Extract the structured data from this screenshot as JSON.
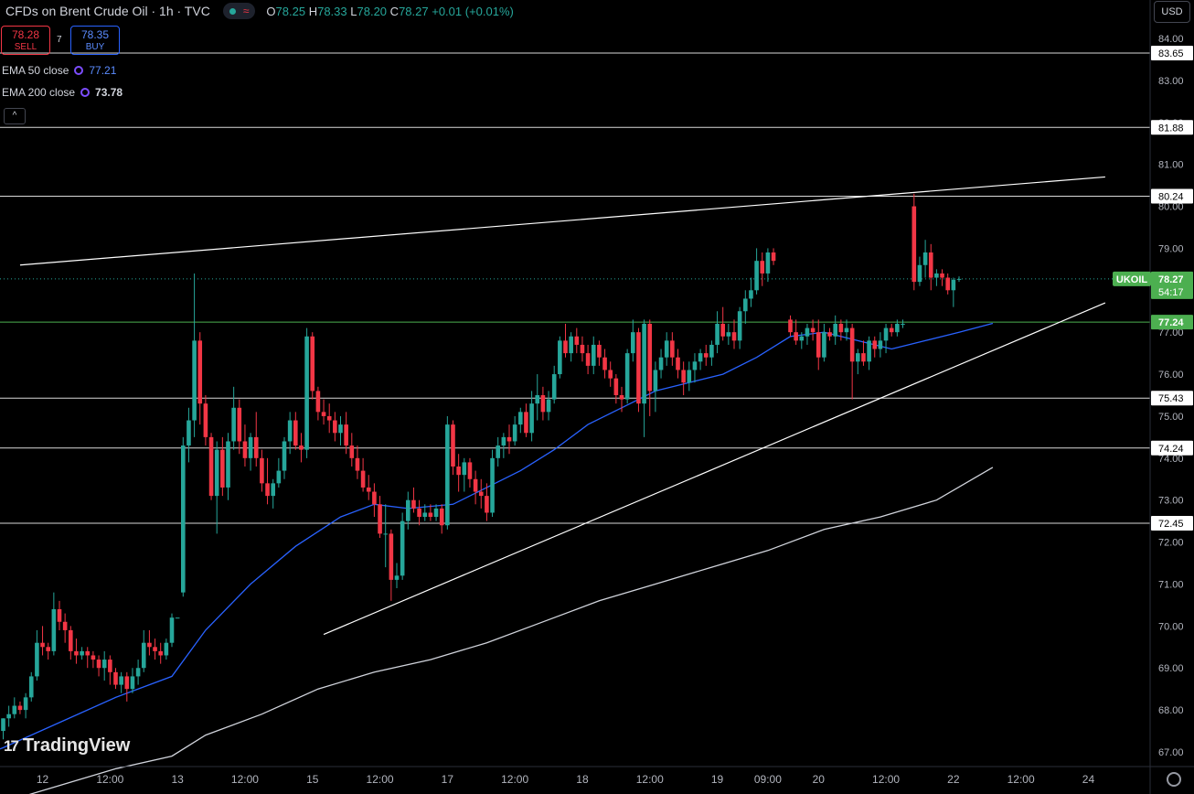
{
  "header": {
    "title": "CFDs on Brent Crude Oil · 1h · TVC",
    "wave_icon": "≈",
    "ohlc": [
      {
        "k": "O",
        "v": "78.25"
      },
      {
        "k": "H",
        "v": "78.33"
      },
      {
        "k": "L",
        "v": "78.20"
      },
      {
        "k": "C",
        "v": "78.27"
      }
    ],
    "change": "+0.01 (+0.01%)"
  },
  "trade": {
    "sell_price": "78.28",
    "sell_label": "SELL",
    "spread": "7",
    "buy_price": "78.35",
    "buy_label": "BUY"
  },
  "indicators": [
    {
      "label": "EMA 50 close",
      "value": "77.21",
      "color": "#2962ff"
    },
    {
      "label": "EMA 200 close",
      "value": "73.78",
      "color": "#d1d4dc"
    }
  ],
  "collapse_icon": "^",
  "currency": "USD",
  "branding": "TradingView",
  "chart_data": {
    "type": "candlestick",
    "symbol_label": "UKOIL",
    "last_price": "78.27",
    "countdown": "54:17",
    "colors": {
      "up": "#26a69a",
      "down": "#f23645",
      "ema50": "#2962ff",
      "ema200": "#d1d4dc",
      "tag_green": "#4caf50"
    },
    "ylim": [
      66.4,
      84.6
    ],
    "y_ticks": [
      "84.00",
      "83.00",
      "82.00",
      "81.00",
      "80.00",
      "79.00",
      "78.00",
      "77.00",
      "76.00",
      "75.00",
      "74.00",
      "73.00",
      "72.00",
      "71.00",
      "70.00",
      "69.00",
      "68.00",
      "67.00"
    ],
    "x_ticks": [
      {
        "label": "12:00",
        "i": -5
      },
      {
        "label": "12",
        "i": 7
      },
      {
        "label": "12:00",
        "i": 19
      },
      {
        "label": "13",
        "i": 31
      },
      {
        "label": "12:00",
        "i": 43
      },
      {
        "label": "15",
        "i": 55
      },
      {
        "label": "12:00",
        "i": 67
      },
      {
        "label": "17",
        "i": 79
      },
      {
        "label": "12:00",
        "i": 91
      },
      {
        "label": "18",
        "i": 103
      },
      {
        "label": "12:00",
        "i": 115
      },
      {
        "label": "19",
        "i": 127
      },
      {
        "label": "09:00",
        "i": 136
      },
      {
        "label": "20",
        "i": 145
      },
      {
        "label": "12:00",
        "i": 157
      },
      {
        "label": "22",
        "i": 169
      },
      {
        "label": "12:00",
        "i": 181
      },
      {
        "label": "24",
        "i": 193
      }
    ],
    "levels": [
      {
        "value": 83.65,
        "label": "83.65",
        "color": "#ffffff"
      },
      {
        "value": 81.88,
        "label": "81.88",
        "color": "#ffffff"
      },
      {
        "value": 80.24,
        "label": "80.24",
        "color": "#ffffff"
      },
      {
        "value": 77.24,
        "label": "77.24",
        "color": "#4caf50"
      },
      {
        "value": 75.43,
        "label": "75.43",
        "color": "#ffffff"
      },
      {
        "value": 74.24,
        "label": "74.24",
        "color": "#ffffff"
      },
      {
        "value": 72.45,
        "label": "72.45",
        "color": "#ffffff"
      }
    ],
    "trendlines": [
      {
        "from": [
          3,
          78.6
        ],
        "to": [
          196,
          80.7
        ]
      },
      {
        "from": [
          57,
          69.8
        ],
        "to": [
          196,
          77.7
        ]
      }
    ],
    "ema50": [
      [
        -6,
        66.8
      ],
      [
        0,
        67.1
      ],
      [
        10,
        67.7
      ],
      [
        20,
        68.3
      ],
      [
        30,
        68.8
      ],
      [
        36,
        69.9
      ],
      [
        44,
        71.0
      ],
      [
        52,
        71.9
      ],
      [
        60,
        72.6
      ],
      [
        66,
        72.9
      ],
      [
        72,
        72.8
      ],
      [
        80,
        72.9
      ],
      [
        86,
        73.3
      ],
      [
        92,
        73.7
      ],
      [
        98,
        74.2
      ],
      [
        104,
        74.8
      ],
      [
        110,
        75.2
      ],
      [
        116,
        75.6
      ],
      [
        122,
        75.8
      ],
      [
        128,
        76.0
      ],
      [
        134,
        76.4
      ],
      [
        140,
        76.9
      ],
      [
        146,
        77.0
      ],
      [
        152,
        76.8
      ],
      [
        158,
        76.6
      ],
      [
        164,
        76.8
      ],
      [
        170,
        77.0
      ],
      [
        176,
        77.21
      ]
    ],
    "ema200": [
      [
        -6,
        65.6
      ],
      [
        0,
        65.8
      ],
      [
        10,
        66.2
      ],
      [
        20,
        66.6
      ],
      [
        30,
        66.9
      ],
      [
        36,
        67.4
      ],
      [
        46,
        67.9
      ],
      [
        56,
        68.5
      ],
      [
        66,
        68.9
      ],
      [
        76,
        69.2
      ],
      [
        86,
        69.6
      ],
      [
        96,
        70.1
      ],
      [
        106,
        70.6
      ],
      [
        116,
        71.0
      ],
      [
        126,
        71.4
      ],
      [
        136,
        71.8
      ],
      [
        146,
        72.3
      ],
      [
        156,
        72.6
      ],
      [
        166,
        73.0
      ],
      [
        176,
        73.78
      ]
    ],
    "candles": [
      [
        67.5,
        67.8,
        67.3,
        67.8
      ],
      [
        67.8,
        68.1,
        67.6,
        67.9
      ],
      [
        67.9,
        68.3,
        67.8,
        68.1
      ],
      [
        68.1,
        68.2,
        67.9,
        68.0
      ],
      [
        68.0,
        68.4,
        67.8,
        68.3
      ],
      [
        68.3,
        68.9,
        68.2,
        68.8
      ],
      [
        68.8,
        69.9,
        68.7,
        69.6
      ],
      [
        69.6,
        70.0,
        69.3,
        69.5
      ],
      [
        69.5,
        69.6,
        69.2,
        69.4
      ],
      [
        69.4,
        70.8,
        69.3,
        70.4
      ],
      [
        70.4,
        70.6,
        69.9,
        70.1
      ],
      [
        70.1,
        70.3,
        69.6,
        69.9
      ],
      [
        69.9,
        70.0,
        69.2,
        69.4
      ],
      [
        69.4,
        69.7,
        69.1,
        69.3
      ],
      [
        69.3,
        69.5,
        69.2,
        69.4
      ],
      [
        69.4,
        69.5,
        69.0,
        69.3
      ],
      [
        69.3,
        69.4,
        69.0,
        69.2
      ],
      [
        69.2,
        69.3,
        68.8,
        69.0
      ],
      [
        69.0,
        69.4,
        68.7,
        69.2
      ],
      [
        69.2,
        69.3,
        68.6,
        68.9
      ],
      [
        68.9,
        69.0,
        68.5,
        68.6
      ],
      [
        68.6,
        68.9,
        68.4,
        68.8
      ],
      [
        68.8,
        68.9,
        68.2,
        68.5
      ],
      [
        68.5,
        69.0,
        68.4,
        68.8
      ],
      [
        68.8,
        69.2,
        68.6,
        69.0
      ],
      [
        69.0,
        69.9,
        68.9,
        69.6
      ],
      [
        69.6,
        69.9,
        69.3,
        69.5
      ],
      [
        69.5,
        69.7,
        69.2,
        69.4
      ],
      [
        69.4,
        69.6,
        69.1,
        69.3
      ],
      [
        69.3,
        69.7,
        69.2,
        69.6
      ],
      [
        69.6,
        70.3,
        69.5,
        70.2
      ],
      [
        70.2,
        70.2,
        70.2,
        70.2
      ],
      [
        70.8,
        74.5,
        70.7,
        74.3
      ],
      [
        74.3,
        75.2,
        73.9,
        74.9
      ],
      [
        74.9,
        78.4,
        74.5,
        76.8
      ],
      [
        76.8,
        77.0,
        74.8,
        75.3
      ],
      [
        75.3,
        75.5,
        74.3,
        74.5
      ],
      [
        74.5,
        74.6,
        73.0,
        73.1
      ],
      [
        73.1,
        74.4,
        72.2,
        74.2
      ],
      [
        74.2,
        74.5,
        73.1,
        73.3
      ],
      [
        73.3,
        74.6,
        73.0,
        74.4
      ],
      [
        74.4,
        75.7,
        74.2,
        75.2
      ],
      [
        75.2,
        75.4,
        74.1,
        74.4
      ],
      [
        74.4,
        74.8,
        73.8,
        74.0
      ],
      [
        74.0,
        74.6,
        73.7,
        74.5
      ],
      [
        74.5,
        75.1,
        73.8,
        74.0
      ],
      [
        74.0,
        74.2,
        73.2,
        73.4
      ],
      [
        73.4,
        74.0,
        72.9,
        73.1
      ],
      [
        73.1,
        73.5,
        72.8,
        73.4
      ],
      [
        73.4,
        74.0,
        73.3,
        73.7
      ],
      [
        73.7,
        74.5,
        73.5,
        74.4
      ],
      [
        74.4,
        75.1,
        74.1,
        74.9
      ],
      [
        74.9,
        75.1,
        74.2,
        74.3
      ],
      [
        74.3,
        74.6,
        73.9,
        74.2
      ],
      [
        74.2,
        77.1,
        74.0,
        76.9
      ],
      [
        76.9,
        77.0,
        75.4,
        75.6
      ],
      [
        75.6,
        75.7,
        74.9,
        75.1
      ],
      [
        75.1,
        75.4,
        74.8,
        75.0
      ],
      [
        75.0,
        75.3,
        74.6,
        74.9
      ],
      [
        74.9,
        75.1,
        74.4,
        74.6
      ],
      [
        74.6,
        75.0,
        74.3,
        74.8
      ],
      [
        74.8,
        75.1,
        74.1,
        74.3
      ],
      [
        74.3,
        74.6,
        73.8,
        74.0
      ],
      [
        74.0,
        74.3,
        73.5,
        73.7
      ],
      [
        73.7,
        74.0,
        73.2,
        73.3
      ],
      [
        73.3,
        73.6,
        73.0,
        73.2
      ],
      [
        73.2,
        73.4,
        72.6,
        72.9
      ],
      [
        72.9,
        73.1,
        72.1,
        72.2
      ],
      [
        72.2,
        72.9,
        71.4,
        72.2
      ],
      [
        72.2,
        72.3,
        70.6,
        71.1
      ],
      [
        71.1,
        71.5,
        70.9,
        71.2
      ],
      [
        71.2,
        72.7,
        71.1,
        72.5
      ],
      [
        72.5,
        73.2,
        72.3,
        73.0
      ],
      [
        73.0,
        73.3,
        72.7,
        72.8
      ],
      [
        72.8,
        73.0,
        72.4,
        72.6
      ],
      [
        72.6,
        72.9,
        72.5,
        72.7
      ],
      [
        72.7,
        72.9,
        72.5,
        72.6
      ],
      [
        72.6,
        72.9,
        72.5,
        72.8
      ],
      [
        72.8,
        72.9,
        72.2,
        72.4
      ],
      [
        72.4,
        75.0,
        72.3,
        74.8
      ],
      [
        74.8,
        74.9,
        73.6,
        73.8
      ],
      [
        73.8,
        74.1,
        73.2,
        73.6
      ],
      [
        73.6,
        74.0,
        73.2,
        73.9
      ],
      [
        73.9,
        74.0,
        73.3,
        73.5
      ],
      [
        73.5,
        73.7,
        72.9,
        73.2
      ],
      [
        73.2,
        73.5,
        72.8,
        73.1
      ],
      [
        73.1,
        73.4,
        72.5,
        72.7
      ],
      [
        72.7,
        74.2,
        72.6,
        74.0
      ],
      [
        74.0,
        74.5,
        73.8,
        74.3
      ],
      [
        74.3,
        74.6,
        74.0,
        74.5
      ],
      [
        74.5,
        74.8,
        74.1,
        74.4
      ],
      [
        74.4,
        75.0,
        74.3,
        74.8
      ],
      [
        74.8,
        75.2,
        74.6,
        75.1
      ],
      [
        75.1,
        75.3,
        74.5,
        74.6
      ],
      [
        74.6,
        75.6,
        74.4,
        75.3
      ],
      [
        75.3,
        76.0,
        74.9,
        75.5
      ],
      [
        75.5,
        75.7,
        74.9,
        75.1
      ],
      [
        75.1,
        75.6,
        74.9,
        75.4
      ],
      [
        75.4,
        76.2,
        75.3,
        76.0
      ],
      [
        76.0,
        76.9,
        75.9,
        76.8
      ],
      [
        76.8,
        77.2,
        76.4,
        76.5
      ],
      [
        76.5,
        77.0,
        76.3,
        76.9
      ],
      [
        76.9,
        77.1,
        76.5,
        76.7
      ],
      [
        76.7,
        76.9,
        76.3,
        76.5
      ],
      [
        76.5,
        76.7,
        76.0,
        76.2
      ],
      [
        76.2,
        76.9,
        76.0,
        76.7
      ],
      [
        76.7,
        76.8,
        76.2,
        76.4
      ],
      [
        76.4,
        76.6,
        75.9,
        76.1
      ],
      [
        76.1,
        76.3,
        75.7,
        75.9
      ],
      [
        75.9,
        76.0,
        75.3,
        75.5
      ],
      [
        75.5,
        75.7,
        75.1,
        75.4
      ],
      [
        75.4,
        76.6,
        75.3,
        76.5
      ],
      [
        76.5,
        77.3,
        76.3,
        77.0
      ],
      [
        77.0,
        77.1,
        75.1,
        75.3
      ],
      [
        75.3,
        77.3,
        74.5,
        77.2
      ],
      [
        77.2,
        77.3,
        75.0,
        75.6
      ],
      [
        75.6,
        76.3,
        75.1,
        76.1
      ],
      [
        76.1,
        76.6,
        75.9,
        76.4
      ],
      [
        76.4,
        77.0,
        76.2,
        76.8
      ],
      [
        76.8,
        77.0,
        76.2,
        76.4
      ],
      [
        76.4,
        76.6,
        75.9,
        76.1
      ],
      [
        76.1,
        76.3,
        75.5,
        75.8
      ],
      [
        75.8,
        76.3,
        75.6,
        76.1
      ],
      [
        76.1,
        76.5,
        75.8,
        76.3
      ],
      [
        76.3,
        76.6,
        76.1,
        76.5
      ],
      [
        76.5,
        76.7,
        76.2,
        76.4
      ],
      [
        76.4,
        76.8,
        76.2,
        76.7
      ],
      [
        76.7,
        77.5,
        76.5,
        77.2
      ],
      [
        77.2,
        77.6,
        76.8,
        76.9
      ],
      [
        76.9,
        77.2,
        76.7,
        77.0
      ],
      [
        77.0,
        77.3,
        76.6,
        76.8
      ],
      [
        76.8,
        77.6,
        76.6,
        77.5
      ],
      [
        77.5,
        78.0,
        77.2,
        77.8
      ],
      [
        77.8,
        78.3,
        77.6,
        78.0
      ],
      [
        78.0,
        79.0,
        77.9,
        78.7
      ],
      [
        78.7,
        78.9,
        78.1,
        78.4
      ],
      [
        78.4,
        79.0,
        78.2,
        78.9
      ],
      [
        78.9,
        79.0,
        78.6,
        78.7
      ],
      null,
      null,
      [
        77.3,
        77.4,
        76.9,
        77.0
      ],
      [
        77.0,
        77.3,
        76.7,
        76.8
      ],
      [
        76.8,
        77.0,
        76.6,
        76.9
      ],
      [
        76.9,
        77.2,
        76.7,
        77.1
      ],
      [
        77.1,
        77.3,
        76.8,
        77.0
      ],
      [
        77.0,
        77.3,
        76.1,
        76.4
      ],
      [
        76.4,
        77.2,
        76.3,
        77.0
      ],
      [
        77.0,
        77.1,
        76.8,
        76.9
      ],
      [
        76.9,
        77.4,
        76.7,
        77.2
      ],
      [
        77.2,
        77.3,
        76.8,
        77.0
      ],
      [
        77.0,
        77.3,
        76.8,
        77.1
      ],
      [
        77.1,
        77.2,
        75.4,
        76.3
      ],
      [
        76.3,
        76.6,
        76.0,
        76.5
      ],
      [
        76.5,
        76.8,
        76.2,
        76.3
      ],
      [
        76.3,
        76.9,
        76.1,
        76.8
      ],
      [
        76.8,
        76.9,
        76.4,
        76.6
      ],
      [
        76.6,
        77.0,
        76.4,
        76.8
      ],
      [
        76.8,
        77.2,
        76.5,
        77.1
      ],
      [
        77.1,
        77.2,
        76.9,
        77.0
      ],
      [
        77.0,
        77.3,
        76.9,
        77.2
      ],
      [
        77.2,
        77.3,
        77.1,
        77.2
      ],
      null,
      [
        80.0,
        80.3,
        78.0,
        78.2
      ],
      [
        78.2,
        78.8,
        78.1,
        78.6
      ],
      [
        78.6,
        79.2,
        78.3,
        78.9
      ],
      [
        78.9,
        79.1,
        78.0,
        78.3
      ],
      [
        78.3,
        78.5,
        78.1,
        78.4
      ],
      [
        78.4,
        78.5,
        78.1,
        78.3
      ],
      [
        78.3,
        78.4,
        77.9,
        78.0
      ],
      [
        78.0,
        78.3,
        77.6,
        78.25
      ],
      [
        78.25,
        78.33,
        78.2,
        78.27
      ]
    ]
  }
}
